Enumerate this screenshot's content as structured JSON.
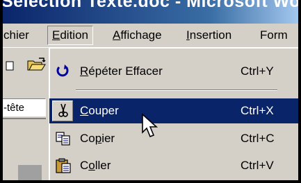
{
  "window": {
    "title": "Sélection Texte.doc - Microsoft Word"
  },
  "menubar": {
    "items": [
      {
        "label": "Fichier",
        "visible_label": "chier"
      },
      {
        "label": "Edition",
        "mnemonic": "E",
        "rest": "dition",
        "active": true
      },
      {
        "label": "Affichage",
        "mnemonic": "A",
        "rest": "ffichage"
      },
      {
        "label": "Insertion",
        "mnemonic": "I",
        "rest": "nsertion"
      },
      {
        "label": "Format",
        "visible_label": "Form"
      }
    ]
  },
  "toolbar": {
    "style_box_value": "-tête"
  },
  "edition_menu": {
    "items": [
      {
        "label_pre": "",
        "mnemonic": "R",
        "label_post": "épéter Effacer",
        "shortcut": "Ctrl+Y",
        "icon": "redo-icon"
      },
      {
        "label_pre": "",
        "mnemonic": "C",
        "label_post": "ouper",
        "shortcut": "Ctrl+X",
        "icon": "scissors-icon",
        "highlighted": true
      },
      {
        "label_pre": "Co",
        "mnemonic": "p",
        "label_post": "ier",
        "shortcut": "Ctrl+C",
        "icon": "copy-icon"
      },
      {
        "label_pre": "C",
        "mnemonic": "o",
        "label_post": "ller",
        "shortcut": "Ctrl+V",
        "icon": "paste-icon"
      }
    ]
  },
  "colors": {
    "menu_bg": "#d4d0c8",
    "highlight": "#0a246a",
    "titlebar_start": "#0a246a",
    "titlebar_end": "#a6caf0"
  }
}
